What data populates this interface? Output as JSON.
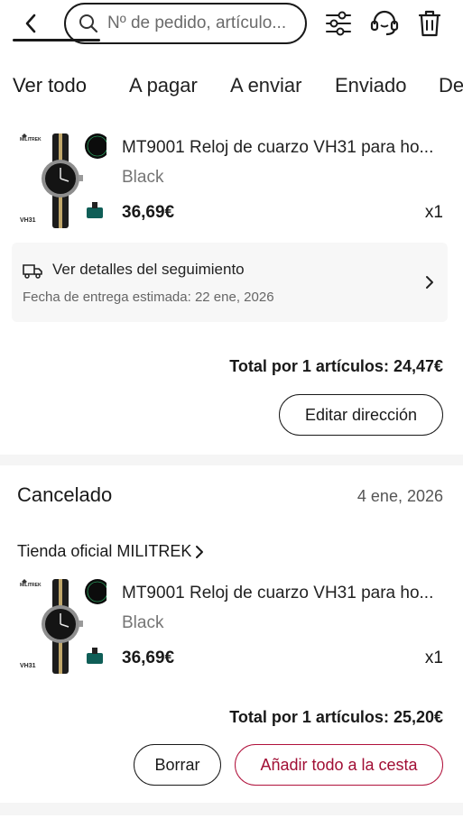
{
  "header": {
    "search_placeholder": "Nº de pedido, artículo..."
  },
  "tabs": [
    {
      "label": "Ver todo",
      "active": true
    },
    {
      "label": "A pagar"
    },
    {
      "label": "A enviar"
    },
    {
      "label": "Enviado"
    },
    {
      "label": "De"
    }
  ],
  "order1": {
    "product": {
      "brand_mark": "MILITREK",
      "thumb_label": "VH31",
      "title": "MT9001 Reloj de cuarzo VH31 para ho...",
      "variant": "Black",
      "price": "36,69€",
      "qty": "x1"
    },
    "tracking": {
      "title": "Ver detalles del seguimiento",
      "subtitle": "Fecha de entrega estimada: 22 ene, 2026"
    },
    "total": "Total por 1 artículos: 24,47€",
    "action": "Editar dirección"
  },
  "order2": {
    "status": "Cancelado",
    "date": "4 ene, 2026",
    "store": "Tienda oficial MILITREK",
    "product": {
      "brand_mark": "MILITREK",
      "thumb_label": "VH31",
      "title": "MT9001 Reloj de cuarzo VH31 para ho...",
      "variant": "Black",
      "price": "36,69€",
      "qty": "x1"
    },
    "total": "Total por 1 artículos: 25,20€",
    "delete_label": "Borrar",
    "add_all_label": "Añadir todo a la cesta"
  },
  "colors": {
    "accent": "#a10f35",
    "text": "#191919",
    "muted": "#757575"
  }
}
